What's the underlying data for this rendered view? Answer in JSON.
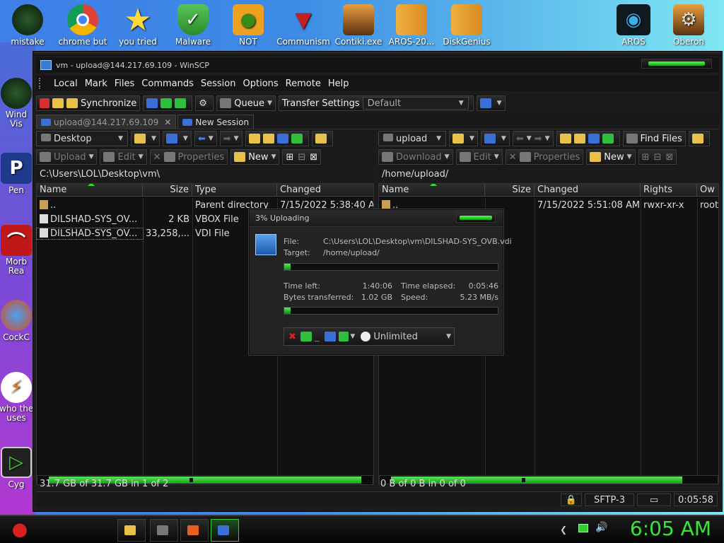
{
  "desktop": {
    "top_icons": [
      {
        "label": "mistake",
        "icon": "green-orb-icon"
      },
      {
        "label": "chrome but",
        "icon": "chrome-icon"
      },
      {
        "label": "you tried",
        "icon": "star-icon"
      },
      {
        "label": "Malware",
        "icon": "shield-check-icon"
      },
      {
        "label": "NOT",
        "icon": "angry-pig-icon"
      },
      {
        "label": "Communism",
        "icon": "emblem-icon"
      },
      {
        "label": "Contiki.exe",
        "icon": "app-icon"
      },
      {
        "label": "AROS-20...",
        "icon": "folder-zip-icon"
      },
      {
        "label": "DiskGenius",
        "icon": "folder-zip-icon"
      },
      {
        "label": "AROS",
        "icon": "cat-eye-icon"
      },
      {
        "label": "Oberon",
        "icon": "app-gear-icon"
      }
    ],
    "left_icons": [
      {
        "label": "Wind\nVis",
        "icon": "green-orb-icon"
      },
      {
        "label": "Pen",
        "icon": "p-app-icon"
      },
      {
        "label": "Morb\nRea",
        "icon": "pdf-icon"
      },
      {
        "label": "CockC",
        "icon": "browser-icon"
      },
      {
        "label": "who the\nuses",
        "icon": "lightning-icon"
      },
      {
        "label": "Cyg",
        "icon": "terminal-icon"
      }
    ]
  },
  "window": {
    "title": "vm - upload@144.217.69.109 - WinSCP",
    "menu": [
      "Local",
      "Mark",
      "Files",
      "Commands",
      "Session",
      "Options",
      "Remote",
      "Help"
    ],
    "toolbar": {
      "synchronize": "Synchronize",
      "queue": "Queue",
      "transfer_settings_label": "Transfer Settings",
      "transfer_settings_value": "Default"
    },
    "tabs": [
      {
        "label": "upload@144.217.69.109",
        "close": "✕"
      },
      {
        "label": "New Session"
      }
    ],
    "left": {
      "location": "Desktop",
      "actions": {
        "upload": "Upload",
        "edit": "Edit",
        "properties": "Properties",
        "new": "New"
      },
      "path": "C:\\Users\\LOL\\Desktop\\vm\\",
      "columns": [
        "Name",
        "Size",
        "Type",
        "Changed"
      ],
      "rows": [
        {
          "name": "..",
          "size": "",
          "type": "Parent directory",
          "changed": "7/15/2022  5:38:40 AM"
        },
        {
          "name": "DILSHAD-SYS_OV...",
          "size": "2 KB",
          "type": "VBOX File",
          "changed": ""
        },
        {
          "name": "DILSHAD-SYS_OV...",
          "size": "33,258,...",
          "type": "VDI File",
          "changed": ""
        }
      ],
      "status": "31.7 GB of 31.7 GB in 1 of 2"
    },
    "right": {
      "location": "upload",
      "find_files": "Find Files",
      "actions": {
        "download": "Download",
        "edit": "Edit",
        "properties": "Properties",
        "new": "New"
      },
      "path": "/home/upload/",
      "columns": [
        "Name",
        "Size",
        "Changed",
        "Rights",
        "Ow"
      ],
      "rows": [
        {
          "name": "..",
          "size": "",
          "changed": "7/15/2022 5:51:08 AM",
          "rights": "rwxr-xr-x",
          "owner": "root"
        }
      ],
      "status": "0 B of 0 B in 0 of 0"
    },
    "statusbar": {
      "protocol": "SFTP-3",
      "time": "0:05:58"
    }
  },
  "progress_dialog": {
    "title": "3% Uploading",
    "file_label": "File:",
    "file_value": "C:\\Users\\LOL\\Desktop\\vm\\DILSHAD-SYS_OVB.vdi",
    "target_label": "Target:",
    "target_value": "/home/upload/",
    "file_progress": 0.03,
    "time_left_label": "Time left:",
    "time_left": "1:40:06",
    "time_elapsed_label": "Time elapsed:",
    "time_elapsed": "0:05:46",
    "bytes_label": "Bytes transferred:",
    "bytes": "1.02 GB",
    "speed_label": "Speed:",
    "speed": "5.23 MB/s",
    "total_progress": 0.03,
    "speed_limit": "Unlimited"
  },
  "taskbar": {
    "clock": "6:05 AM",
    "clock_color": "#37e637"
  }
}
